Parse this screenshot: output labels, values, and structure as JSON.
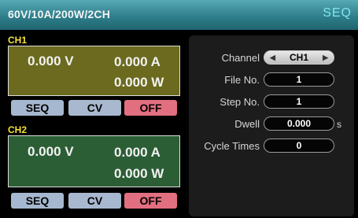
{
  "header": {
    "model": "60V/10A/200W/2CH",
    "mode": "SEQ"
  },
  "channels": [
    {
      "label": "CH1",
      "voltage": "0.000 V",
      "current": "0.000 A",
      "power": "0.000 W",
      "buttons": {
        "seq": "SEQ",
        "cv": "CV",
        "off": "OFF"
      }
    },
    {
      "label": "CH2",
      "voltage": "0.000 V",
      "current": "0.000 A",
      "power": "0.000 W",
      "buttons": {
        "seq": "SEQ",
        "cv": "CV",
        "off": "OFF"
      }
    }
  ],
  "settings": {
    "channel": {
      "label": "Channel",
      "value": "CH1"
    },
    "file_no": {
      "label": "File No.",
      "value": "1"
    },
    "step_no": {
      "label": "Step No.",
      "value": "1"
    },
    "dwell": {
      "label": "Dwell",
      "value": "0.000",
      "unit": "s"
    },
    "cycle_times": {
      "label": "Cycle Times",
      "value": "0"
    }
  }
}
